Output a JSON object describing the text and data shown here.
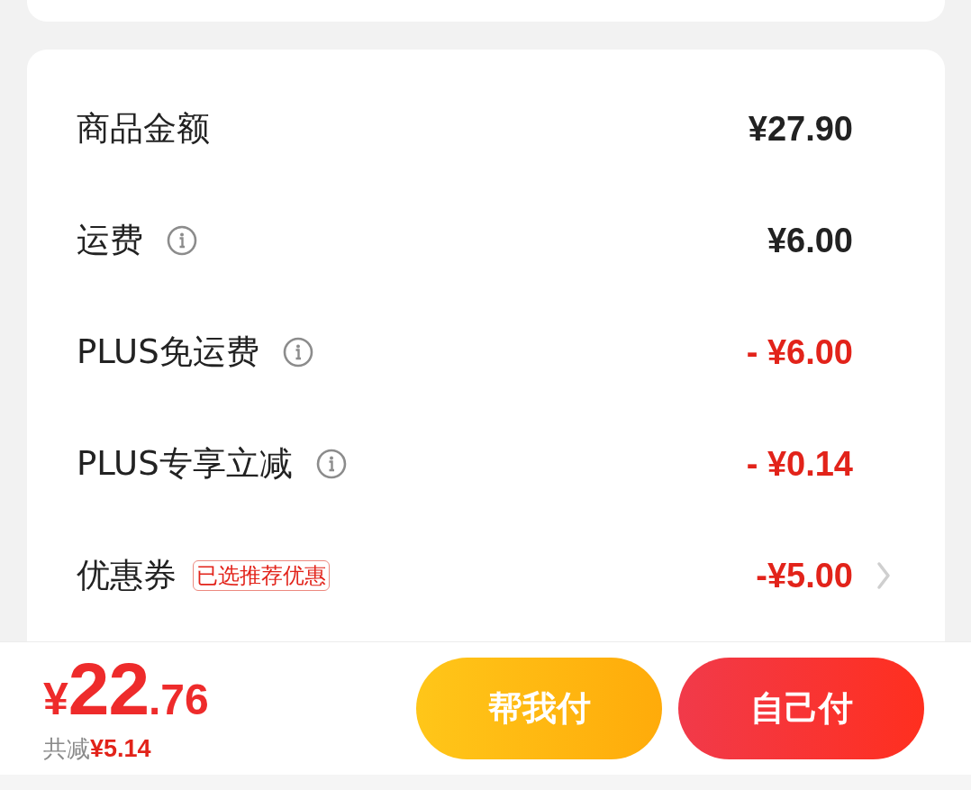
{
  "summary": {
    "rows": [
      {
        "label": "商品金额",
        "info": false,
        "value": "¥27.90",
        "kind": "amount",
        "chevron": false
      },
      {
        "label": "运费",
        "info": true,
        "value": "¥6.00",
        "kind": "amount",
        "chevron": false
      },
      {
        "label": "PLUS免运费",
        "info": true,
        "value": "- ¥6.00",
        "kind": "discount",
        "chevron": false
      },
      {
        "label": "PLUS专享立减",
        "info": true,
        "value": "- ¥0.14",
        "kind": "discount",
        "chevron": false
      },
      {
        "label": "优惠券",
        "info": false,
        "tag": "已选推荐优惠",
        "value": "-¥5.00",
        "kind": "discount",
        "chevron": true
      }
    ]
  },
  "checkout_bar": {
    "total": {
      "currency": "¥",
      "integer": "22",
      "decimal": ".76"
    },
    "savings": {
      "label": "共减",
      "amount": "¥5.14"
    },
    "buttons": [
      {
        "label": "帮我付",
        "kind": "secondary"
      },
      {
        "label": "自己付",
        "kind": "primary"
      }
    ]
  }
}
